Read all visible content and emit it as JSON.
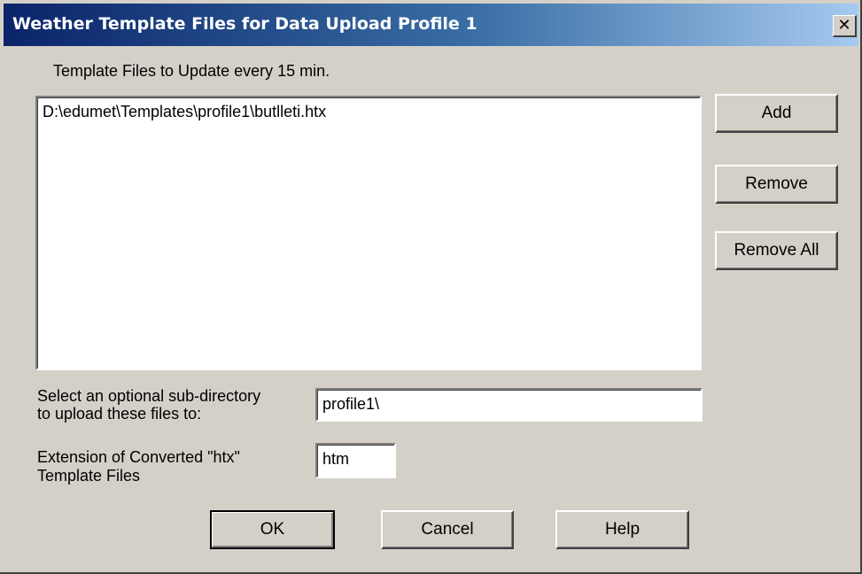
{
  "window": {
    "title": "Weather Template Files for Data Upload Profile 1",
    "close_glyph": "✕"
  },
  "files_section": {
    "label": "Template Files to Update every 15 min.",
    "items": [
      "D:\\edumet\\Templates\\profile1\\butlleti.htx"
    ]
  },
  "side_buttons": {
    "add": "Add",
    "remove": "Remove",
    "remove_all": "Remove All"
  },
  "subdirectory": {
    "label_line1": "Select an optional sub-directory",
    "label_line2": "to upload these files to:",
    "value": "profile1\\"
  },
  "extension": {
    "label_line1": "Extension of Converted \"htx\"",
    "label_line2": "Template Files",
    "value": "htm"
  },
  "bottom_buttons": {
    "ok": "OK",
    "cancel": "Cancel",
    "help": "Help"
  }
}
